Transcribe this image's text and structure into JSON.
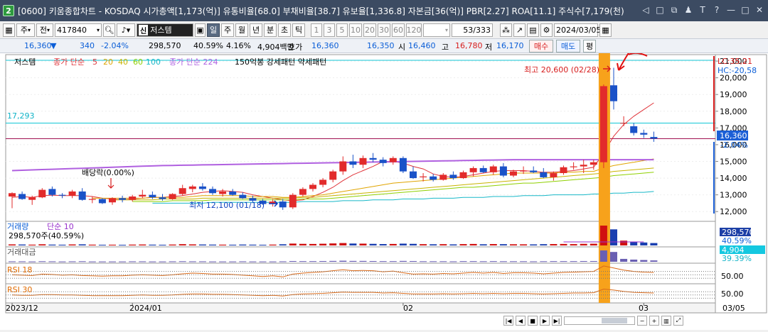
{
  "window": {
    "icon_label": "2",
    "title": "[0600] 키움종합차트 - KOSDAQ 시가총액[1,173(억)] 유통비율[68.0] 부채비율[38.7] 유보율[1,336.8] 자본금[36(억)] PBR[2.27] ROA[11.1] 주식수[7,179(천)",
    "tool_icons": [
      "◁",
      "□",
      "⧉",
      "♟",
      "T",
      "?",
      "—",
      "□",
      "✕"
    ]
  },
  "toolbar": {
    "period_select": "주",
    "prev_label": "전",
    "code_value": "417840",
    "market_tag": "신",
    "stock_name": "저스템",
    "period_buttons": [
      "일",
      "주",
      "월",
      "년",
      "분",
      "초",
      "틱"
    ],
    "active_period": "일",
    "minute_buttons": [
      "1",
      "3",
      "5",
      "10",
      "20",
      "30",
      "60",
      "120"
    ],
    "page_counter": "53/333",
    "date_value": "2024/03/05"
  },
  "quote": {
    "price": "16,360",
    "arrow": "▼",
    "change": "340",
    "change_pct": "-2.04%",
    "volume": "298,570",
    "volume_ratio": "40.59%",
    "turnover": "4.16%",
    "amount": "4,904백만",
    "ask_label": "호가",
    "ask1": "16,360",
    "ask2": "16,350",
    "open_label": "시",
    "open": "16,460",
    "high_label": "고",
    "high": "16,780",
    "low_label": "저",
    "low": "16,170",
    "buy_label": "매수",
    "sell_label": "매도",
    "eval_label": "평"
  },
  "price_pane": {
    "legend_name": "저스템",
    "legend_ma": "종가 단순",
    "ma_periods": [
      "5",
      "20",
      "40",
      "60",
      "100"
    ],
    "ma_colors": [
      "#e0343a",
      "#e0a400",
      "#c8b400",
      "#8fd000",
      "#18b8c8"
    ],
    "ma_long": "종가 단순 224",
    "ma_long_color": "#b060e0",
    "legend_extra": "150억봉 강세패턴  약세패턴",
    "y_ticks": [
      "21,000",
      "20,000",
      "19,000",
      "18,000",
      "17,000",
      "16,000",
      "15,000",
      "14,000",
      "13,000",
      "12,000"
    ],
    "lc_label": "LC:35,21",
    "hc_label": "HC:-20,58",
    "current_price_tag": "16,360",
    "current_pct_tag": "-2.04%",
    "hline_label": "17,293",
    "max_annot": "최고 20,600 (02/28)",
    "min_annot": "최저 12,100 (01/18)",
    "div_annot": "배당락(0.00%)"
  },
  "volume_pane": {
    "title": "거래량",
    "ma_label": "단순 10",
    "value": "298,570주(40.59%)",
    "tag_value": "298,570",
    "tag_pct": "40.59%"
  },
  "amount_pane": {
    "title": "거래대금",
    "tag_value": "4,904",
    "tag_pct": "39.39%"
  },
  "rsi18_pane": {
    "title": "RSI 18",
    "tag": "50.00"
  },
  "rsi30_pane": {
    "title": "RSI 30",
    "tag": "50.00"
  },
  "x_axis": {
    "labels": [
      "2023/12",
      "2024/01",
      "02",
      "03"
    ],
    "right_label": "03/05"
  },
  "chart_data": {
    "type": "candlestick",
    "ylim": [
      11500,
      21300
    ],
    "hline": 17293,
    "candles": [
      [
        12900,
        13150,
        12200,
        13100
      ],
      [
        13050,
        13200,
        12700,
        12750
      ],
      [
        12700,
        12950,
        12400,
        12850
      ],
      [
        12850,
        13400,
        12800,
        13300
      ],
      [
        13350,
        13500,
        12900,
        13000
      ],
      [
        13000,
        13100,
        12800,
        12950
      ],
      [
        12950,
        13300,
        12800,
        13200
      ],
      [
        13200,
        13400,
        12650,
        12700
      ],
      [
        12700,
        12900,
        12500,
        12750
      ],
      [
        12750,
        12800,
        12450,
        12500
      ],
      [
        12550,
        12850,
        12400,
        12800
      ],
      [
        12800,
        12950,
        12550,
        12700
      ],
      [
        12700,
        13000,
        12600,
        12900
      ],
      [
        12900,
        13300,
        12800,
        13000
      ],
      [
        13000,
        13200,
        12750,
        12850
      ],
      [
        12850,
        13050,
        12650,
        12750
      ],
      [
        12750,
        13100,
        12700,
        13050
      ],
      [
        13050,
        13600,
        12950,
        13400
      ],
      [
        13350,
        13600,
        13150,
        13500
      ],
      [
        13500,
        13700,
        13250,
        13350
      ],
      [
        13350,
        13500,
        13000,
        13100
      ],
      [
        13050,
        13350,
        12900,
        13200
      ],
      [
        13200,
        13350,
        12950,
        13000
      ],
      [
        13000,
        13150,
        12750,
        12800
      ],
      [
        12800,
        12950,
        12550,
        12650
      ],
      [
        12650,
        12750,
        12400,
        12450
      ],
      [
        12450,
        12750,
        12300,
        12600
      ],
      [
        12600,
        12750,
        12100,
        12250
      ],
      [
        12250,
        13100,
        12150,
        13000
      ],
      [
        13000,
        13450,
        12900,
        13350
      ],
      [
        13350,
        13700,
        13200,
        13600
      ],
      [
        13600,
        14000,
        13450,
        13900
      ],
      [
        13900,
        14500,
        13750,
        14400
      ],
      [
        14400,
        15300,
        14200,
        15000
      ],
      [
        15000,
        15400,
        14600,
        14800
      ],
      [
        14800,
        15350,
        14600,
        15200
      ],
      [
        15200,
        15500,
        14950,
        15100
      ],
      [
        15100,
        15250,
        14700,
        14900
      ],
      [
        14950,
        15300,
        14800,
        15200
      ],
      [
        15200,
        15300,
        14300,
        14400
      ],
      [
        14400,
        14700,
        13950,
        14000
      ],
      [
        14050,
        14300,
        13800,
        14100
      ],
      [
        14100,
        14250,
        13800,
        13900
      ],
      [
        13900,
        14300,
        13850,
        14200
      ],
      [
        14200,
        14400,
        13900,
        14000
      ],
      [
        14000,
        14450,
        13950,
        14350
      ],
      [
        14350,
        14700,
        14100,
        14600
      ],
      [
        14600,
        14750,
        14300,
        14350
      ],
      [
        14350,
        14800,
        14200,
        14700
      ],
      [
        14700,
        14900,
        14050,
        14150
      ],
      [
        14150,
        14500,
        14050,
        14400
      ],
      [
        14400,
        14700,
        14250,
        14450
      ],
      [
        14450,
        14700,
        14300,
        14350
      ],
      [
        14350,
        14600,
        14000,
        14050
      ],
      [
        14050,
        14400,
        13850,
        14300
      ],
      [
        14300,
        14750,
        14200,
        14650
      ],
      [
        14650,
        14950,
        14500,
        14700
      ],
      [
        14700,
        15100,
        14300,
        14800
      ],
      [
        14800,
        15100,
        14500,
        14950
      ],
      [
        14950,
        19600,
        14600,
        19500
      ],
      [
        19550,
        20600,
        18100,
        18600
      ],
      [
        17300,
        17700,
        17100,
        17300
      ],
      [
        17100,
        17300,
        16550,
        16700
      ],
      [
        16700,
        16900,
        16400,
        16600
      ],
      [
        16460,
        16780,
        16170,
        16360
      ]
    ],
    "ma_lines": [
      {
        "name": "종가 단순 5",
        "color": "#e0343a",
        "values": [
          12850,
          12900,
          12850,
          12950,
          12980,
          12950,
          12950,
          12950,
          12900,
          12800,
          12750,
          12700,
          12750,
          12800,
          12850,
          12850,
          12900,
          12950,
          13050,
          13150,
          13200,
          13250,
          13200,
          13150,
          13000,
          12900,
          12800,
          12700,
          12650,
          12700,
          12900,
          13150,
          13450,
          13850,
          14200,
          14450,
          14700,
          15000,
          15000,
          14900,
          14700,
          14550,
          14250,
          14100,
          14050,
          14100,
          14200,
          14300,
          14400,
          14450,
          14450,
          14450,
          14400,
          14350,
          14350,
          14400,
          14450,
          14550,
          14650,
          15500,
          16500,
          17200,
          17700,
          18100,
          18500
        ]
      },
      {
        "name": "종가 단순 20",
        "color": "#e0a400",
        "values": [
          null,
          null,
          null,
          null,
          null,
          null,
          null,
          null,
          12800,
          12800,
          12800,
          12800,
          12800,
          12800,
          12850,
          12850,
          12850,
          12850,
          12900,
          12950,
          12950,
          12950,
          12950,
          12950,
          12900,
          12900,
          12900,
          12850,
          12850,
          12900,
          12950,
          13000,
          13100,
          13200,
          13300,
          13400,
          13500,
          13600,
          13700,
          13750,
          13800,
          13850,
          13900,
          13950,
          14000,
          14050,
          14100,
          14150,
          14200,
          14250,
          14300,
          14300,
          14300,
          14300,
          14300,
          14350,
          14350,
          14400,
          14400,
          14600,
          14750,
          14850,
          14950,
          15050,
          15150
        ]
      },
      {
        "name": "종가 단순 40",
        "color": "#c8b400",
        "values": [
          null,
          null,
          null,
          null,
          null,
          null,
          null,
          null,
          null,
          null,
          12700,
          12700,
          12700,
          12700,
          12700,
          12750,
          12750,
          12750,
          12750,
          12800,
          12800,
          12800,
          12800,
          12800,
          12800,
          12800,
          12800,
          12800,
          12800,
          12850,
          12850,
          12900,
          12950,
          13000,
          13050,
          13100,
          13150,
          13200,
          13250,
          13300,
          13350,
          13400,
          13450,
          13500,
          13550,
          13600,
          13650,
          13700,
          13750,
          13800,
          13850,
          13900,
          13950,
          14000,
          14050,
          14100,
          14150,
          14200,
          14250,
          14300,
          14400,
          14450,
          14500,
          14550,
          14600
        ]
      },
      {
        "name": "종가 단순 60",
        "color": "#8fd000",
        "values": [
          null,
          null,
          null,
          null,
          null,
          null,
          null,
          null,
          null,
          null,
          null,
          null,
          12600,
          12600,
          12600,
          12600,
          12650,
          12650,
          12650,
          12650,
          12700,
          12700,
          12700,
          12700,
          12700,
          12700,
          12700,
          12700,
          12700,
          12750,
          12750,
          12750,
          12800,
          12850,
          12900,
          12950,
          13000,
          13050,
          13100,
          13150,
          13200,
          13250,
          13300,
          13350,
          13400,
          13450,
          13450,
          13500,
          13550,
          13600,
          13650,
          13700,
          13700,
          13750,
          13800,
          13850,
          13900,
          13950,
          14000,
          14050,
          14150,
          14200,
          14250,
          14300,
          14350
        ]
      },
      {
        "name": "종가 단순 100",
        "color": "#18b8c8",
        "values": [
          null,
          null,
          null,
          null,
          null,
          null,
          null,
          null,
          null,
          null,
          null,
          null,
          null,
          null,
          12500,
          12500,
          12500,
          12500,
          12500,
          12500,
          12550,
          12550,
          12550,
          12550,
          12550,
          12550,
          12550,
          12550,
          12550,
          12600,
          12600,
          12600,
          12600,
          12650,
          12650,
          12650,
          12700,
          12700,
          12700,
          12750,
          12750,
          12750,
          12800,
          12800,
          12800,
          12850,
          12850,
          12850,
          12900,
          12900,
          12900,
          12950,
          12950,
          12950,
          13000,
          13000,
          13000,
          13000,
          13050,
          13050,
          13100,
          13100,
          13150,
          13150,
          13200
        ]
      },
      {
        "name": "종가 단순 224",
        "color": "#b060e0",
        "values": [
          14450,
          14470,
          14490,
          14510,
          14530,
          14550,
          14570,
          14590,
          14610,
          14630,
          14650,
          14670,
          14690,
          14710,
          14730,
          14750,
          14760,
          14770,
          14780,
          14790,
          14800,
          14810,
          14820,
          14830,
          14840,
          14850,
          14860,
          14870,
          14880,
          14890,
          14900,
          14910,
          14920,
          14930,
          14940,
          14950,
          14960,
          14970,
          14980,
          14990,
          15000,
          15010,
          15020,
          15030,
          15040,
          15050,
          15060,
          15070,
          15080,
          15090,
          15100,
          15100,
          15100,
          15100,
          15100,
          15100,
          15100,
          15100,
          15100,
          15100,
          15100,
          15100,
          15100,
          15100,
          15100
        ]
      }
    ],
    "volume": [
      20,
      18,
      15,
      22,
      16,
      14,
      19,
      21,
      15,
      13,
      14,
      12,
      16,
      18,
      15,
      13,
      17,
      24,
      20,
      18,
      16,
      15,
      14,
      17,
      15,
      13,
      16,
      22,
      35,
      30,
      28,
      32,
      38,
      45,
      36,
      34,
      30,
      26,
      28,
      34,
      30,
      24,
      22,
      24,
      20,
      25,
      28,
      22,
      26,
      24,
      22,
      21,
      20,
      24,
      26,
      28,
      25,
      30,
      32,
      370,
      300,
      90,
      70,
      55,
      45
    ],
    "amount": [
      4,
      4,
      3,
      5,
      4,
      3,
      4,
      5,
      3,
      3,
      3,
      3,
      4,
      4,
      3,
      3,
      4,
      5,
      4,
      4,
      3,
      3,
      3,
      4,
      3,
      3,
      3,
      4,
      7,
      6,
      6,
      7,
      8,
      10,
      8,
      8,
      7,
      6,
      6,
      8,
      7,
      5,
      5,
      5,
      4,
      6,
      6,
      5,
      6,
      5,
      5,
      5,
      4,
      5,
      6,
      6,
      6,
      7,
      7,
      110,
      95,
      28,
      21,
      17,
      13
    ],
    "rsi18": [
      50,
      49,
      48,
      52,
      51,
      49,
      50,
      48,
      47,
      46,
      47,
      47,
      49,
      50,
      49,
      48,
      50,
      53,
      55,
      54,
      52,
      52,
      51,
      49,
      47,
      45,
      47,
      44,
      52,
      55,
      57,
      59,
      62,
      65,
      62,
      63,
      62,
      59,
      61,
      56,
      52,
      53,
      52,
      54,
      53,
      55,
      57,
      55,
      57,
      54,
      56,
      56,
      55,
      53,
      55,
      57,
      58,
      59,
      60,
      76,
      70,
      64,
      60,
      58,
      57
    ],
    "rsi30": [
      50,
      49,
      49,
      51,
      51,
      50,
      50,
      49,
      48,
      48,
      48,
      48,
      49,
      50,
      49,
      49,
      50,
      52,
      53,
      53,
      52,
      52,
      51,
      50,
      49,
      48,
      49,
      47,
      51,
      53,
      54,
      55,
      57,
      59,
      58,
      58,
      58,
      56,
      57,
      55,
      53,
      53,
      53,
      54,
      53,
      54,
      55,
      54,
      55,
      54,
      55,
      55,
      54,
      53,
      54,
      55,
      56,
      56,
      57,
      68,
      65,
      61,
      58,
      57,
      56
    ]
  }
}
